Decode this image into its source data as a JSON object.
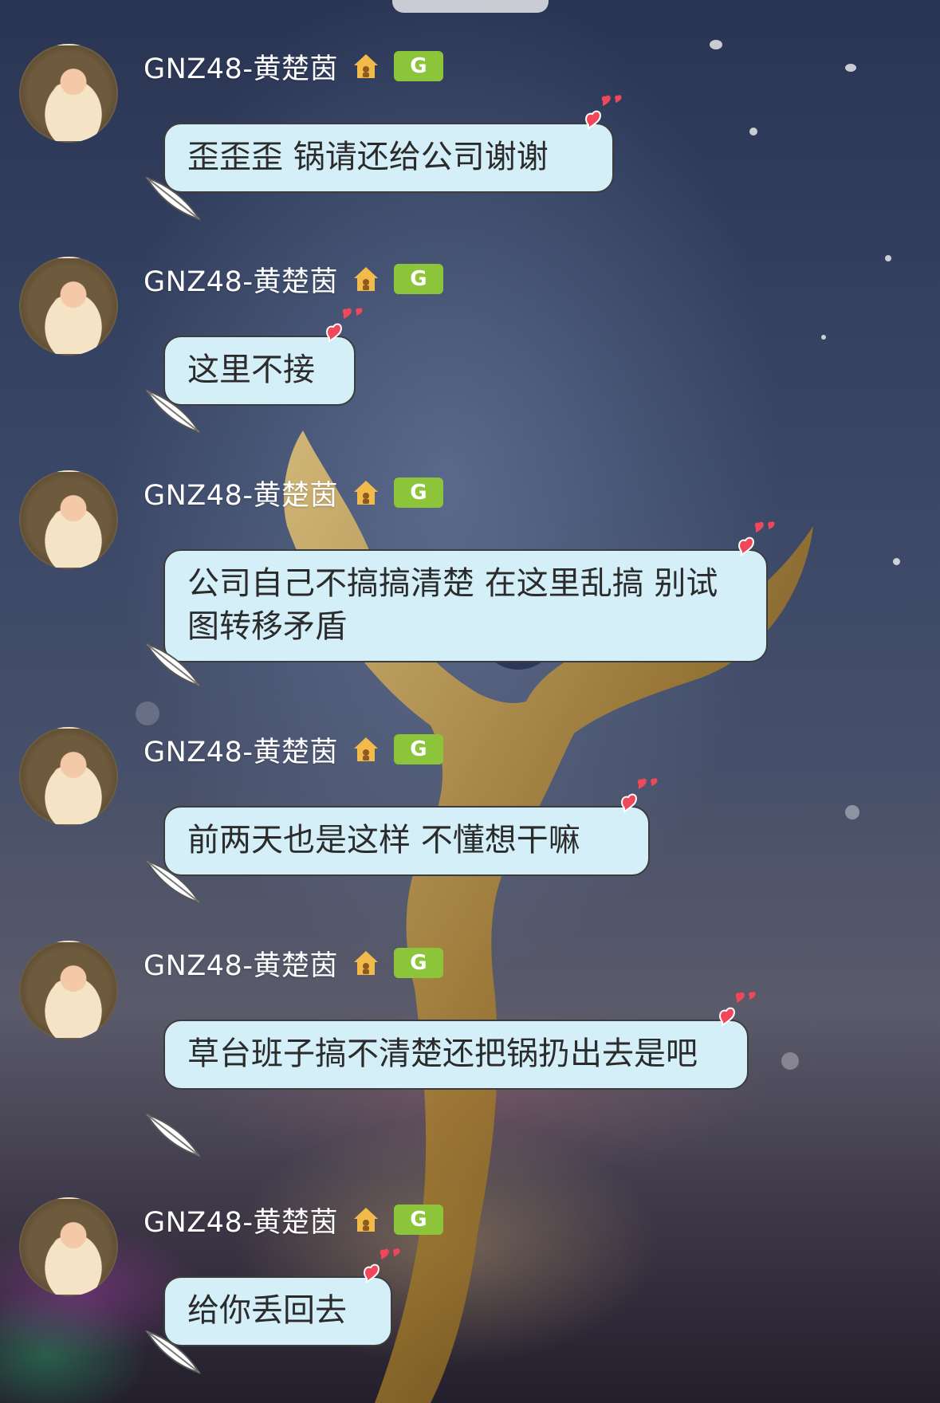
{
  "messages": [
    {
      "sender": "GNZ48-黄楚茵",
      "badge": "G",
      "text": "歪歪歪 锅请还给公司谢谢"
    },
    {
      "sender": "GNZ48-黄楚茵",
      "badge": "G",
      "text": "这里不接"
    },
    {
      "sender": "GNZ48-黄楚茵",
      "badge": "G",
      "text": "公司自己不搞搞清楚 在这里乱搞 别试图转移矛盾"
    },
    {
      "sender": "GNZ48-黄楚茵",
      "badge": "G",
      "text": "前两天也是这样 不懂想干嘛"
    },
    {
      "sender": "GNZ48-黄楚茵",
      "badge": "G",
      "text": "草台班子搞不清楚还把锅扔出去是吧"
    },
    {
      "sender": "GNZ48-黄楚茵",
      "badge": "G",
      "text": "给你丢回去"
    }
  ],
  "colors": {
    "bubble_bg": "#d4eff8",
    "bubble_border": "#3c3c3c",
    "badge_green": "#8cc43a",
    "heart_red": "#f0485a"
  }
}
